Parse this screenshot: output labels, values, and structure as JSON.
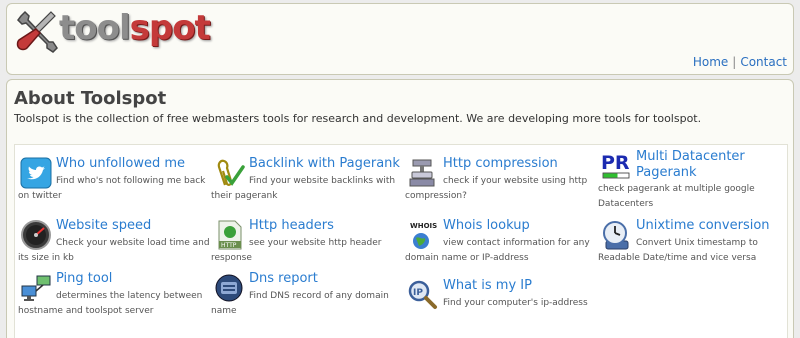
{
  "header": {
    "logo": {
      "text_tool": "tool",
      "text_spot": "spot",
      "icon": "wrench-screwdriver-icon"
    },
    "nav": {
      "home": "Home",
      "separator": "|",
      "contact": "Contact"
    }
  },
  "main": {
    "title": "About Toolspot",
    "intro": "Toolspot is the collection of free webmasters tools for research and development. We are developing more tools for toolspot."
  },
  "tools": [
    {
      "name": "Who unfollowed me",
      "desc": "Find who's not following me back on twitter",
      "icon": "twitter-icon"
    },
    {
      "name": "Backlink with Pagerank",
      "desc": "Find your website backlinks with their pagerank",
      "icon": "paperclip-check-icon"
    },
    {
      "name": "Http compression",
      "desc": "check if your website using http compression?",
      "icon": "compression-vise-icon"
    },
    {
      "name": "Multi Datacenter Pagerank",
      "desc": "check pagerank at multiple google Datacenters",
      "icon": "pagerank-pr-icon"
    },
    {
      "name": "Website speed",
      "desc": "Check your website load time and its size in kb",
      "icon": "speedometer-icon"
    },
    {
      "name": "Http headers",
      "desc": "see your website http header response",
      "icon": "http-document-icon"
    },
    {
      "name": "Whois lookup",
      "desc": "view contact information for any domain name or IP-address",
      "icon": "whois-globe-icon"
    },
    {
      "name": "Unixtime conversion",
      "desc": "Convert Unix timestamp to Readable Date/time and vice versa",
      "icon": "clock-icon"
    },
    {
      "name": "Ping tool",
      "desc": "determines the latency between hostname and toolspot server",
      "icon": "network-computers-icon"
    },
    {
      "name": "Dns report",
      "desc": "Find DNS record of any domain name",
      "icon": "dns-server-icon"
    },
    {
      "name": "What is my IP",
      "desc": "Find your computer's ip-address",
      "icon": "ip-magnifier-icon"
    }
  ],
  "colors": {
    "link": "#2a7ccf",
    "logo_red": "#c43a3a",
    "panel_bg": "#fbfbf6",
    "page_bg": "#ececec"
  }
}
